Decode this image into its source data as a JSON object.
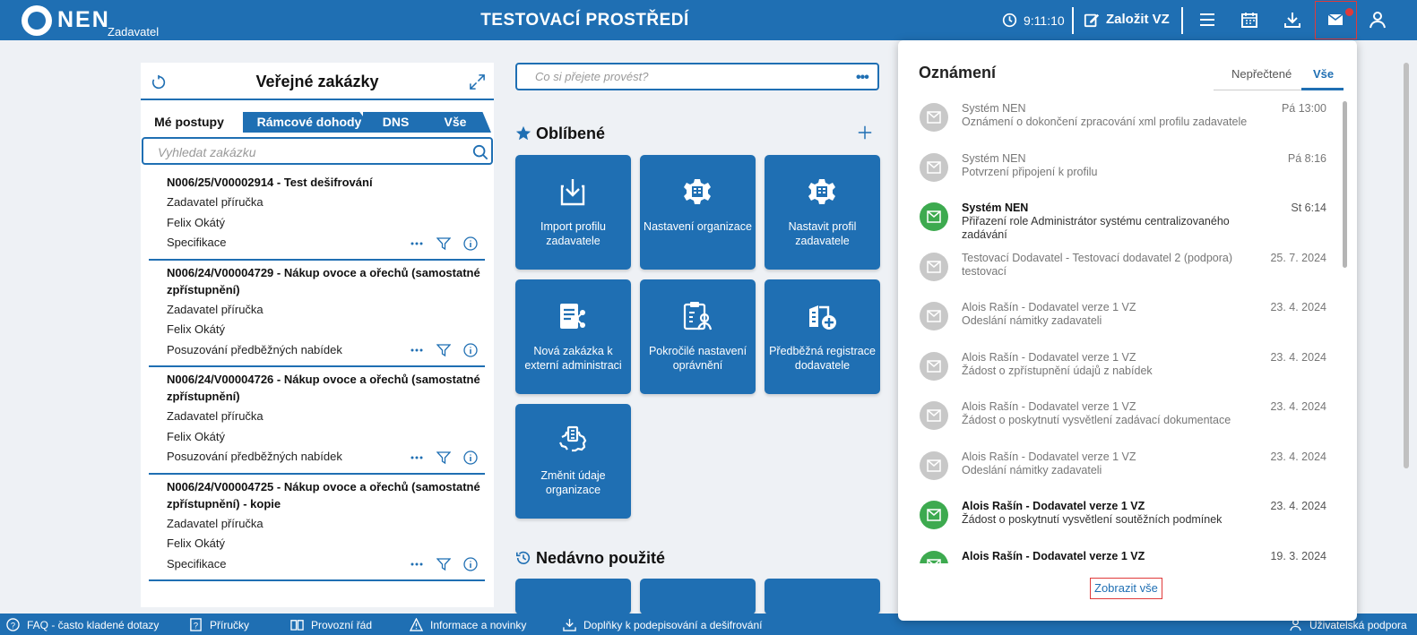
{
  "header": {
    "logo_text": "NEN",
    "logo_sub": "Zadavatel",
    "env_title": "TESTOVACÍ PROSTŘEDÍ",
    "time": "9:11:10",
    "create_label": "Založit VZ",
    "icons": [
      "clock-icon",
      "edit-icon",
      "menu-icon",
      "calendar-icon",
      "download-icon",
      "mail-icon",
      "user-icon"
    ]
  },
  "left_panel": {
    "title": "Veřejné zakázky",
    "tabs": [
      "Mé postupy",
      "Rámcové dohody",
      "DNS",
      "Vše"
    ],
    "search_placeholder": "Vyhledat zakázku",
    "procedures": [
      {
        "title": "N006/25/V00002914 - Test dešifrování",
        "line1": "Zadavatel příručka",
        "line2": "Felix Okátý",
        "line3": "Specifikace"
      },
      {
        "title": "N006/24/V00004729 - Nákup ovoce a ořechů (samostatné zpřístupnění)",
        "line1": "Zadavatel příručka",
        "line2": "Felix Okátý",
        "line3": "Posuzování předběžných nabídek"
      },
      {
        "title": "N006/24/V00004726 - Nákup ovoce a ořechů (samostatné zpřístupnění)",
        "line1": "Zadavatel příručka",
        "line2": "Felix Okátý",
        "line3": "Posuzování předběžných nabídek"
      },
      {
        "title": "N006/24/V00004725 - Nákup ovoce a ořechů (samostatné zpřístupnění) - kopie",
        "line1": "Zadavatel příručka",
        "line2": "Felix Okátý",
        "line3": "Specifikace"
      }
    ]
  },
  "command": {
    "placeholder": "Co si přejete provést?",
    "dots": "•••"
  },
  "favorites": {
    "title": "Oblíbené",
    "tiles": [
      {
        "label": "Import profilu zadavatele",
        "icon": "import-icon"
      },
      {
        "label": "Nastavení organizace",
        "icon": "org-settings-icon"
      },
      {
        "label": "Nastavit profil zadavatele",
        "icon": "profile-settings-icon"
      },
      {
        "label": "Nová zakázka k externí administraci",
        "icon": "new-contract-icon"
      },
      {
        "label": "Pokročilé nastavení oprávnění",
        "icon": "permissions-icon"
      },
      {
        "label": "Předběžná registrace dodavatele",
        "icon": "supplier-registration-icon"
      },
      {
        "label": "Změnit údaje organizace",
        "icon": "org-edit-icon"
      }
    ]
  },
  "recent": {
    "title": "Nedávno použité"
  },
  "notifications": {
    "title": "Oznámení",
    "tab_unread": "Nepřečtené",
    "tab_all": "Vše",
    "show_all": "Zobrazit vše",
    "items": [
      {
        "from": "Systém NEN",
        "msg": "Oznámení o dokončení zpracování xml profilu zadavatele",
        "date": "Pá 13:00",
        "unread": false
      },
      {
        "from": "Systém NEN",
        "msg": "Potvrzení připojení k profilu",
        "date": "Pá 8:16",
        "unread": false
      },
      {
        "from": "Systém NEN",
        "msg": "Přiřazení role Administrátor systému centralizovaného zadávání",
        "date": "St 6:14",
        "unread": true
      },
      {
        "from": "Testovací Dodavatel - Testovací dodavatel 2 (podpora)",
        "msg": "testovací",
        "date": "25. 7. 2024",
        "unread": false
      },
      {
        "from": "Alois Rašín - Dodavatel verze 1 VZ",
        "msg": "Odeslání námitky zadavateli",
        "date": "23. 4. 2024",
        "unread": false
      },
      {
        "from": "Alois Rašín - Dodavatel verze 1 VZ",
        "msg": "Žádost o zpřístupnění údajů z nabídek",
        "date": "23. 4. 2024",
        "unread": false
      },
      {
        "from": "Alois Rašín - Dodavatel verze 1 VZ",
        "msg": "Žádost o poskytnutí vysvětlení zadávací dokumentace",
        "date": "23. 4. 2024",
        "unread": false
      },
      {
        "from": "Alois Rašín - Dodavatel verze 1 VZ",
        "msg": "Odeslání námitky zadavateli",
        "date": "23. 4. 2024",
        "unread": false
      },
      {
        "from": "Alois Rašín - Dodavatel verze 1 VZ",
        "msg": "Žádost o poskytnutí vysvětlení soutěžních podmínek",
        "date": "23. 4. 2024",
        "unread": true
      },
      {
        "from": "Alois Rašín - Dodavatel verze 1 VZ",
        "msg": "",
        "date": "19. 3. 2024",
        "unread": true
      }
    ]
  },
  "footer": {
    "items": [
      "FAQ - často kladené dotazy",
      "Příručky",
      "Provozní řád",
      "Informace a novinky",
      "Doplňky k podepisování a dešifrování"
    ],
    "support": "Uživatelská podpora"
  },
  "colors": {
    "brand": "#1f6fb3",
    "unread_badge": "#3daa4f",
    "alert": "#e03a3a"
  }
}
